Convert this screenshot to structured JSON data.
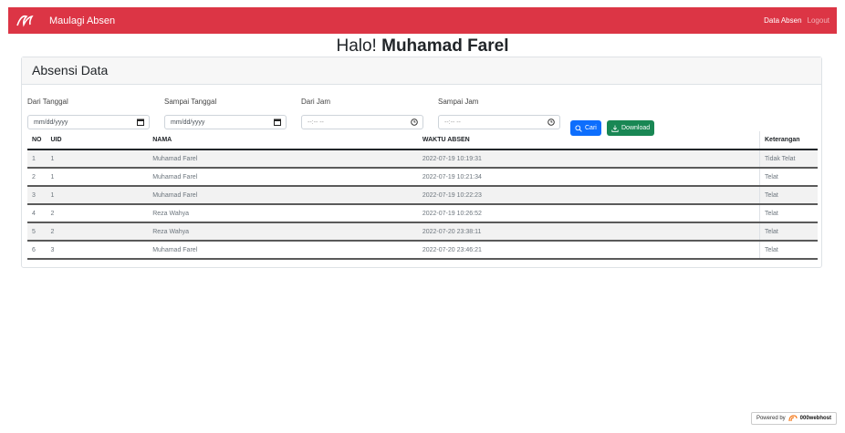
{
  "navbar": {
    "brand": "Maulagi Absen",
    "links": [
      "Data Absen",
      "Logout"
    ],
    "color": "#dc3545"
  },
  "greeting": {
    "prefix": "Halo!",
    "name": "Muhamad Farel"
  },
  "card": {
    "title": "Absensi Data"
  },
  "filters": {
    "dari_tanggal": {
      "label": "Dari Tanggal",
      "value": "mm/dd/yyyy",
      "icon": "calendar-icon"
    },
    "sampai_tanggal": {
      "label": "Sampai Tanggal",
      "value": "mm/dd/yyyy",
      "icon": "calendar-icon"
    },
    "dari_jam": {
      "label": "Dari Jam",
      "value": "--:-- --",
      "icon": "clock-icon"
    },
    "sampai_jam": {
      "label": "Sampai Jam",
      "value": "--:-- --",
      "icon": "clock-icon"
    }
  },
  "buttons": {
    "cari": {
      "label": "Cari",
      "icon": "search-icon",
      "color": "#0d6efd"
    },
    "download": {
      "label": "Download",
      "icon": "download-icon",
      "color": "#198754"
    }
  },
  "table": {
    "headers": [
      "NO",
      "UID",
      "NAMA",
      "WAKTU ABSEN",
      "Keterangan"
    ],
    "rows": [
      [
        "1",
        "1",
        "Muhamad Farel",
        "2022-07-19 10:19:31",
        "Tidak Telat"
      ],
      [
        "2",
        "1",
        "Muhamad Farel",
        "2022-07-19 10:21:34",
        "Telat"
      ],
      [
        "3",
        "1",
        "Muhamad Farel",
        "2022-07-19 10:22:23",
        "Telat"
      ],
      [
        "4",
        "2",
        "Reza Wahya",
        "2022-07-19 10:26:52",
        "Telat"
      ],
      [
        "5",
        "2",
        "Reza Wahya",
        "2022-07-20 23:38:11",
        "Telat"
      ],
      [
        "6",
        "3",
        "Muhamad Farel",
        "2022-07-20 23:46:21",
        "Telat"
      ]
    ]
  },
  "footer": {
    "powered_by": "Powered by",
    "host": "000webhost"
  }
}
